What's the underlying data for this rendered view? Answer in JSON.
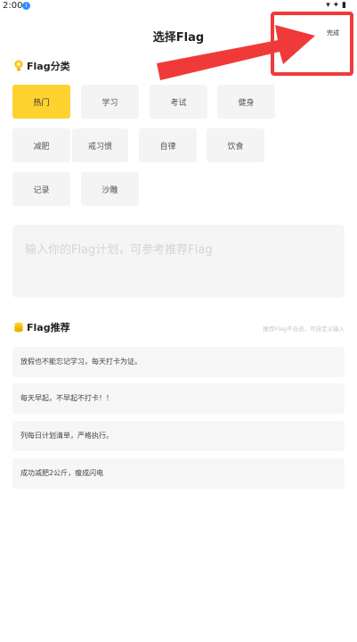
{
  "status_bar": {
    "time": "2:00",
    "notification_badge": "①",
    "right_icons": "▾ ✦ ▮"
  },
  "header": {
    "title": "选择Flag",
    "done_label": "完成"
  },
  "flag_category": {
    "title": "Flag分类",
    "chips": [
      {
        "label": "热门",
        "active": true
      },
      {
        "label": "学习",
        "active": false
      },
      {
        "label": "考试",
        "active": false
      },
      {
        "label": "健身",
        "active": false
      },
      {
        "label": "减肥",
        "active": false
      },
      {
        "label": "戒习惯",
        "active": false
      },
      {
        "label": "自律",
        "active": false
      },
      {
        "label": "饮食",
        "active": false
      },
      {
        "label": "记录",
        "active": false
      },
      {
        "label": "沙雕",
        "active": false
      }
    ]
  },
  "input": {
    "placeholder": "输入你的Flag计划，可参考推荐Flag",
    "value": ""
  },
  "flag_recommend": {
    "title": "Flag推荐",
    "hint": "推荐Flag不合适，可自定义输入",
    "items": [
      "放假也不能忘记学习，每天打卡为证。",
      "每天早起，不早起不打卡！！",
      "列每日计划清单，严格执行。",
      "成功减肥2公斤，瘦成闪电"
    ]
  },
  "colors": {
    "accent": "#fed22f",
    "annotation": "#f03a3a",
    "chip_bg": "#f4f4f4"
  },
  "icons": {
    "category": "lightbulb-icon",
    "recommend": "stack-icon",
    "annotation": "arrow-pointer"
  }
}
